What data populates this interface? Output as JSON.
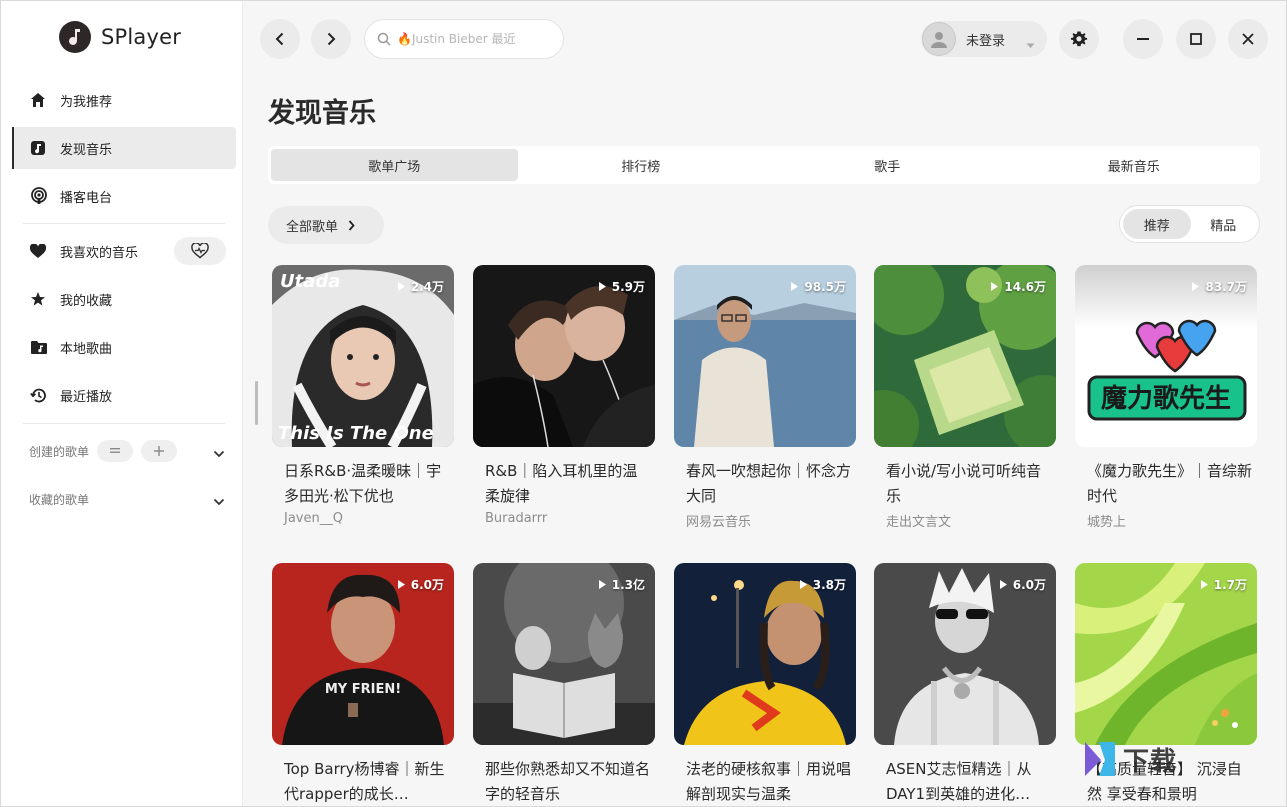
{
  "app": {
    "name": "SPlayer"
  },
  "sidebar": {
    "items": [
      {
        "label": "为我推荐",
        "icon": "home-icon"
      },
      {
        "label": "发现音乐",
        "icon": "music-note-icon",
        "active": true
      },
      {
        "label": "播客电台",
        "icon": "podcast-icon"
      },
      {
        "label": "我喜欢的音乐",
        "icon": "heart-icon"
      },
      {
        "label": "我的收藏",
        "icon": "star-icon"
      },
      {
        "label": "本地歌曲",
        "icon": "folder-music-icon"
      },
      {
        "label": "最近播放",
        "icon": "history-icon"
      }
    ],
    "created_playlists": "创建的歌单",
    "collected_playlists": "收藏的歌单"
  },
  "topbar": {
    "search_placeholder": "🔥Justin Bieber 最近",
    "user": "未登录"
  },
  "main": {
    "title": "发现音乐",
    "tabs": [
      {
        "label": "歌单广场",
        "active": true
      },
      {
        "label": "排行榜"
      },
      {
        "label": "歌手"
      },
      {
        "label": "最新音乐"
      }
    ],
    "all_playlists": "全部歌单",
    "filter": {
      "recommended": "推荐",
      "premium": "精品"
    }
  },
  "playlists": [
    {
      "title": "日系R&B·温柔暖昧｜宇多田光·松下优也",
      "author": "Javen__Q",
      "plays": "2.4万",
      "cover_text_top": "Utada",
      "cover_text_bottom": "This Is The One"
    },
    {
      "title": "R&B｜陷入耳机里的温柔旋律",
      "author": "Buradarrr",
      "plays": "5.9万"
    },
    {
      "title": "春风一吹想起你｜怀念方大同",
      "author": "网易云音乐",
      "plays": "98.5万"
    },
    {
      "title": "看小说/写小说可听纯音乐",
      "author": "走出文言文",
      "plays": "14.6万"
    },
    {
      "title": "《魔力歌先生》｜音综新时代",
      "author": "城势上",
      "plays": "83.7万",
      "cover_text": "魔力歌先生"
    },
    {
      "title": "Top Barry杨博睿｜新生代rapper的成长…",
      "author": "",
      "plays": "6.0万",
      "cover_text": "MY FRIEN!"
    },
    {
      "title": "那些你熟悉却又不知道名字的轻音乐",
      "author": "",
      "plays": "1.3亿"
    },
    {
      "title": "法老的硬核叙事｜用说唱解剖现实与温柔",
      "author": "",
      "plays": "3.8万"
    },
    {
      "title": "ASEN艾志恒精选｜从DAY1到英雄的进化…",
      "author": "",
      "plays": "6.0万"
    },
    {
      "title": "【高质量轻音】 沉浸自然 享受春和景明",
      "author": "",
      "plays": "1.7万"
    }
  ],
  "watermark": "下载"
}
